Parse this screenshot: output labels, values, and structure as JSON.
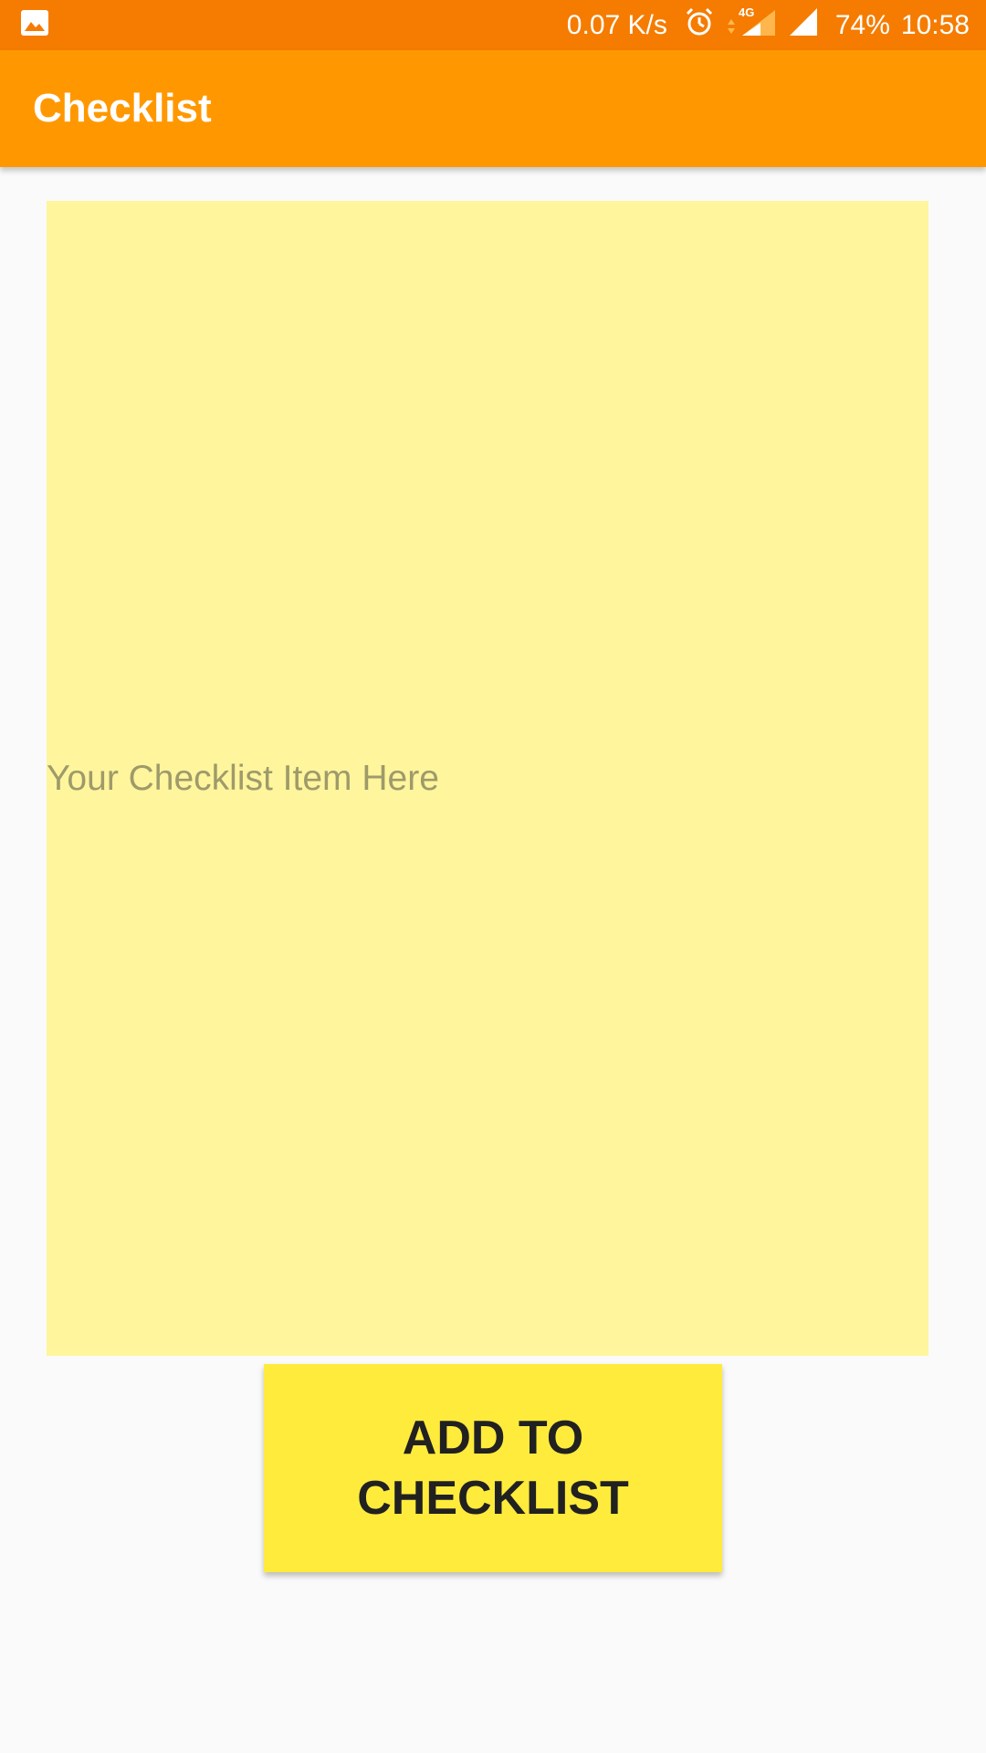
{
  "status_bar": {
    "left_icons": [
      "image-notification-icon"
    ],
    "net_speed": "0.07 K/s",
    "right_icons": [
      "alarm-icon",
      "signal-4g-icon",
      "signal-icon"
    ],
    "network_label": "4G",
    "battery": "74%",
    "time": "10:58"
  },
  "app_bar": {
    "title": "Checklist"
  },
  "input": {
    "placeholder": "Your Checklist Item Here",
    "value": ""
  },
  "button": {
    "label": "ADD TO CHECKLIST"
  },
  "colors": {
    "status_bar": "#F57C00",
    "app_bar": "#FF9800",
    "input_bg": "#FFF59D",
    "button_bg": "#FFEB3B",
    "background": "#FAFAFA"
  }
}
